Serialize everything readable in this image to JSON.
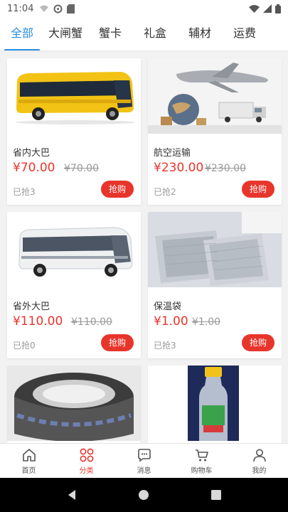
{
  "status_bar": {
    "time": "11:04"
  },
  "tabs": [
    {
      "label": "全部",
      "active": true
    },
    {
      "label": "大闸蟹"
    },
    {
      "label": "蟹卡"
    },
    {
      "label": "礼盒"
    },
    {
      "label": "辅材"
    },
    {
      "label": "运费"
    }
  ],
  "products": [
    {
      "name": "省内大巴",
      "price": "¥70.00",
      "original_price": "¥70.00",
      "sold": "已抢3",
      "buy_label": "抢购",
      "image": "yellow-bus"
    },
    {
      "name": "航空运输",
      "price": "¥230.00",
      "original_price": "¥230.00",
      "sold": "已抢2",
      "buy_label": "抢购",
      "image": "airplane-logistics"
    },
    {
      "name": "省外大巴",
      "price": "¥110.00",
      "original_price": "¥110.00",
      "sold": "已抢0",
      "buy_label": "抢购",
      "image": "white-bus"
    },
    {
      "name": "保温袋",
      "price": "¥1.00",
      "original_price": "¥1.00",
      "sold": "已抢3",
      "buy_label": "抢购",
      "image": "foil-insulation-bag"
    },
    {
      "image": "packing-tape-roll"
    },
    {
      "image": "bottle"
    }
  ],
  "bottom_nav": [
    {
      "label": "首页",
      "icon": "home-icon"
    },
    {
      "label": "分类",
      "icon": "category-icon",
      "active": true
    },
    {
      "label": "消息",
      "icon": "message-icon"
    },
    {
      "label": "购物车",
      "icon": "cart-icon"
    },
    {
      "label": "我的",
      "icon": "user-icon"
    }
  ],
  "colors": {
    "accent_blue": "#2a8de0",
    "price_red": "#e8352b"
  }
}
